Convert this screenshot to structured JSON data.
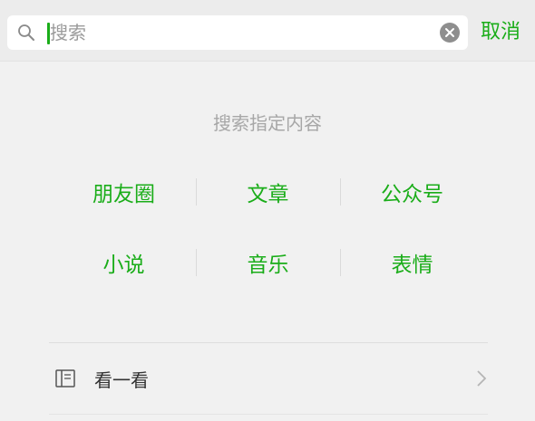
{
  "search": {
    "placeholder": "搜索",
    "value": "",
    "cancel_label": "取消"
  },
  "section": {
    "title": "搜索指定内容"
  },
  "categories": [
    {
      "label": "朋友圈"
    },
    {
      "label": "文章"
    },
    {
      "label": "公众号"
    },
    {
      "label": "小说"
    },
    {
      "label": "音乐"
    },
    {
      "label": "表情"
    }
  ],
  "list": [
    {
      "label": "看一看",
      "icon": "book-icon"
    }
  ],
  "colors": {
    "accent": "#1aad19",
    "muted_text": "#a7a7a7",
    "background": "#f1f1f1"
  }
}
